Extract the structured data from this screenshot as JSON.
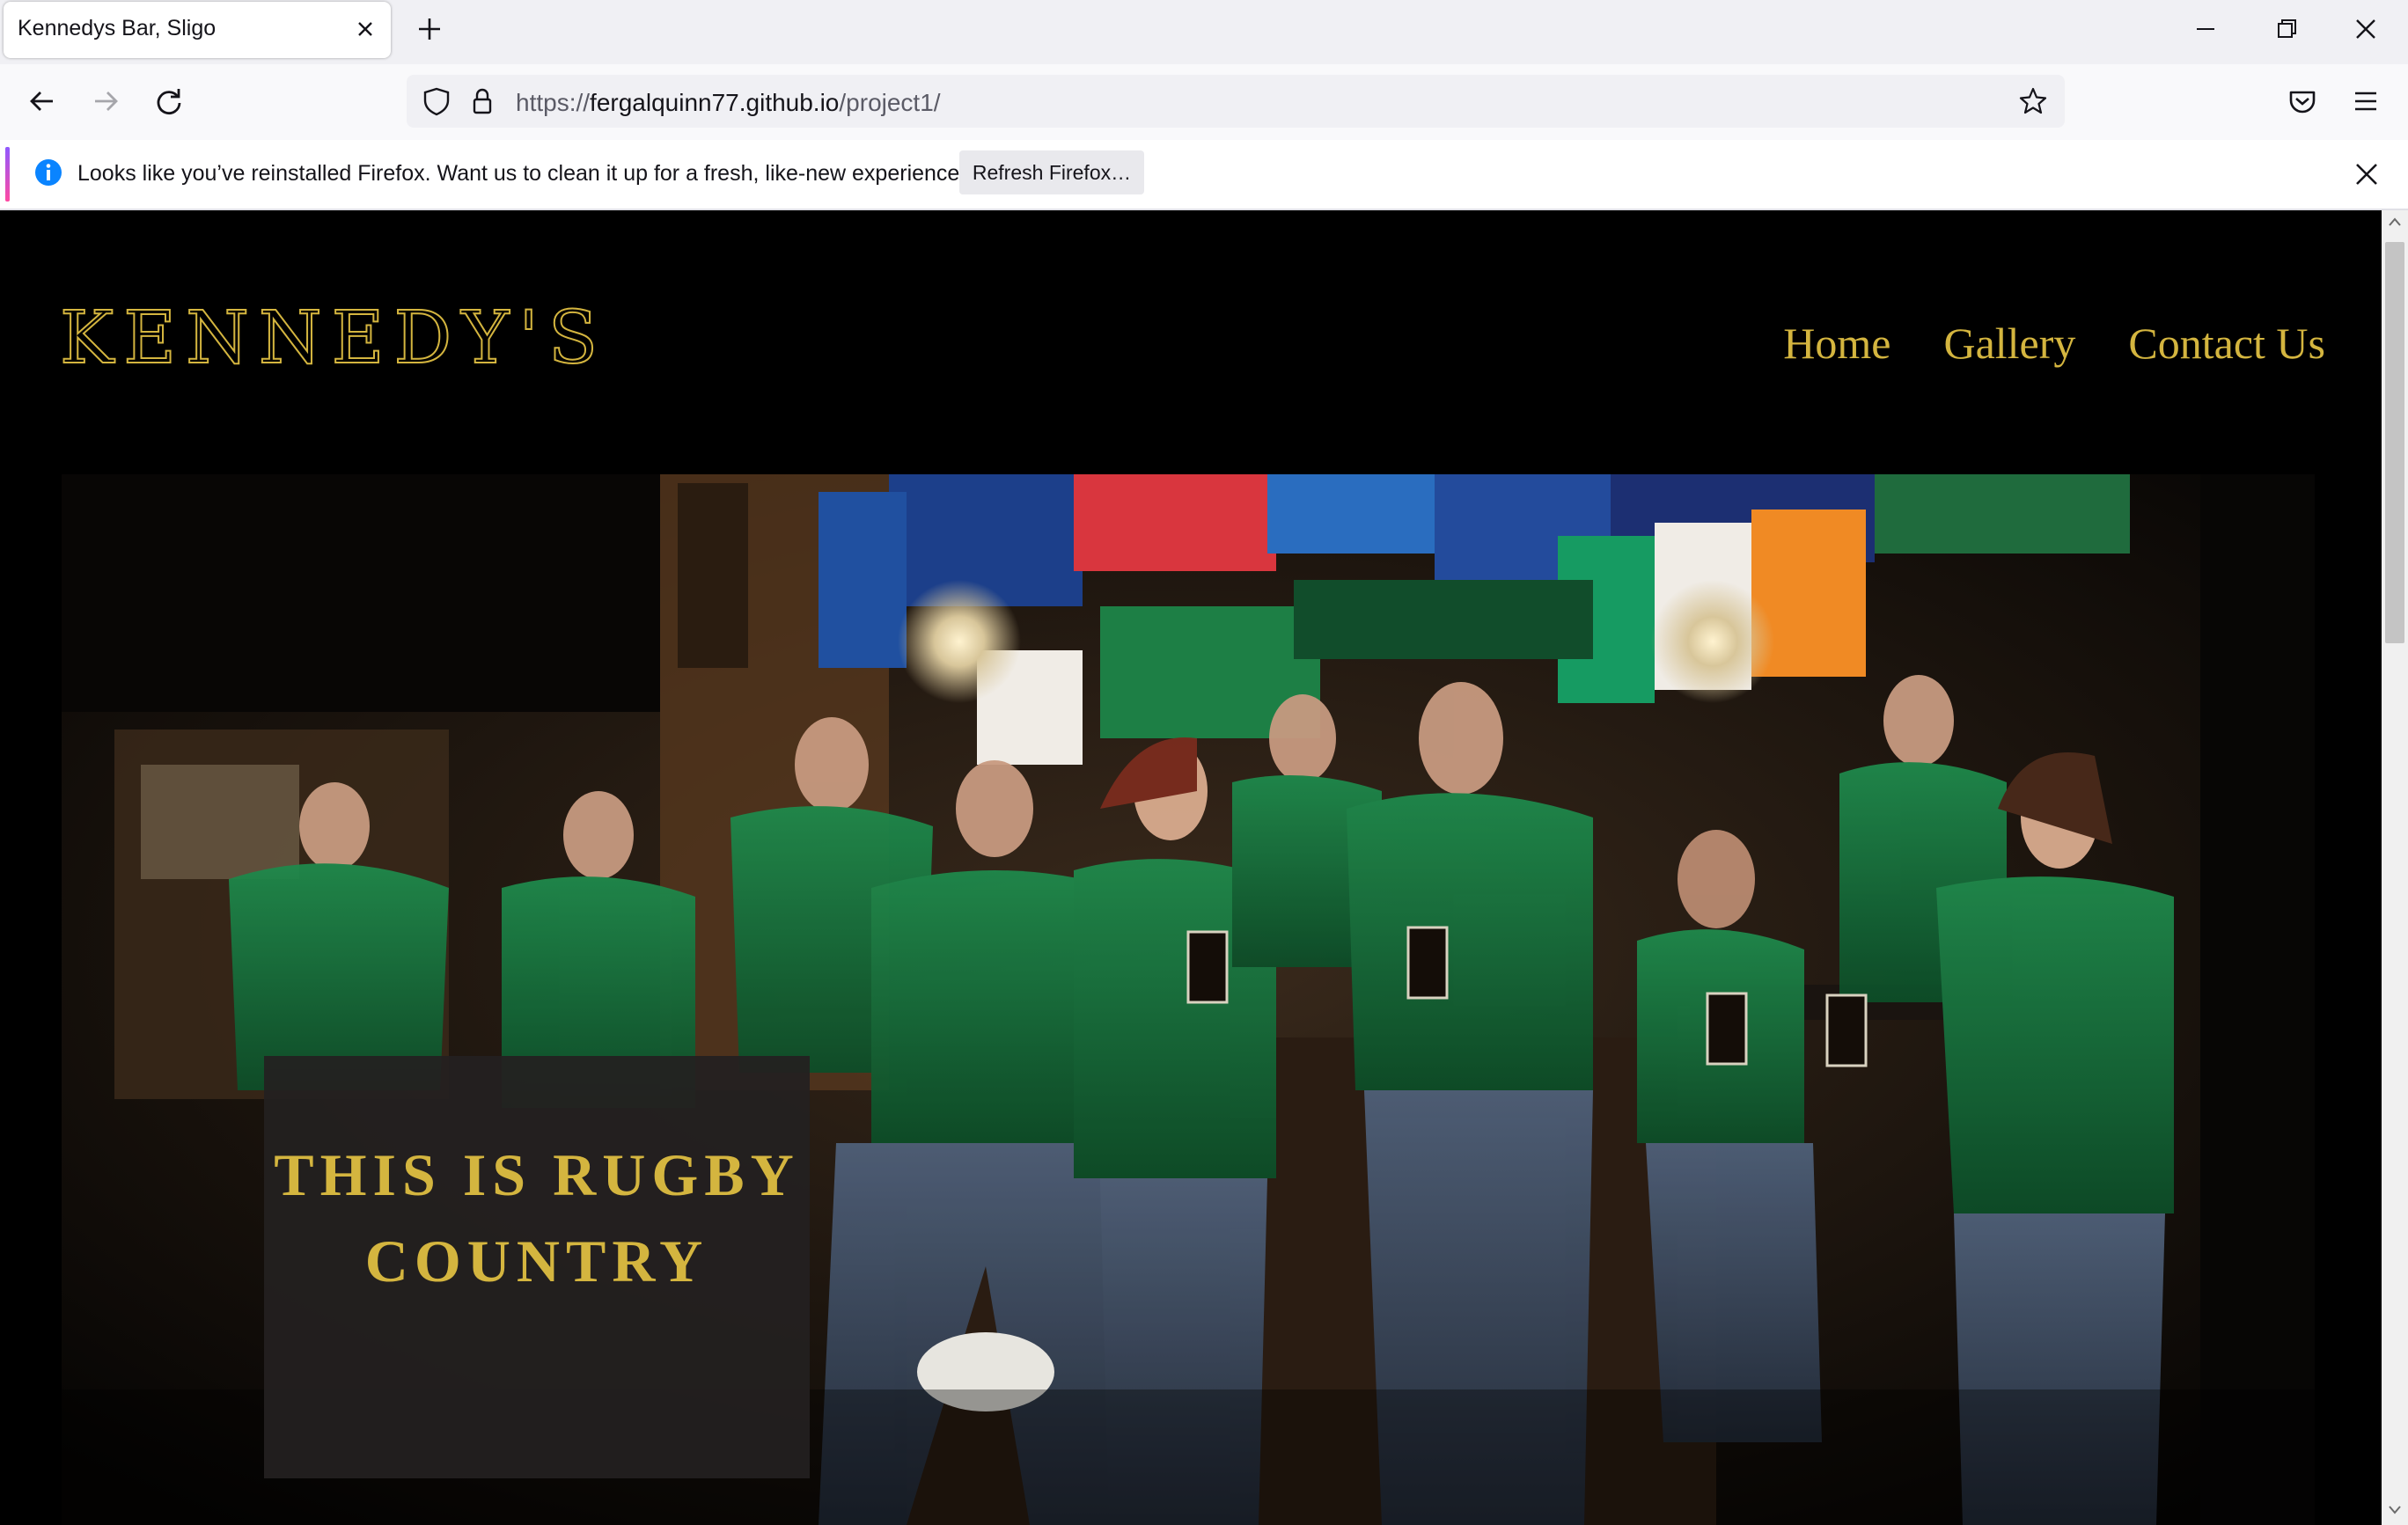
{
  "browser": {
    "tab_title": "Kennedys Bar, Sligo",
    "url_prefix": "https://",
    "url_host": "fergalquinn77.github.io",
    "url_path": "/project1/",
    "notification_text": "Looks like you’ve reinstalled Firefox. Want us to clean it up for a fresh, like-new experience?",
    "notification_button": "Refresh Firefox…"
  },
  "site": {
    "brand": "KENNEDY'S",
    "nav": [
      "Home",
      "Gallery",
      "Contact Us"
    ],
    "hero_caption_line1": "THIS IS RUGBY",
    "hero_caption_line2": "COUNTRY"
  },
  "colors": {
    "accent_gold": "#d4b53f",
    "page_background": "#000000",
    "caption_background": "#242020"
  }
}
